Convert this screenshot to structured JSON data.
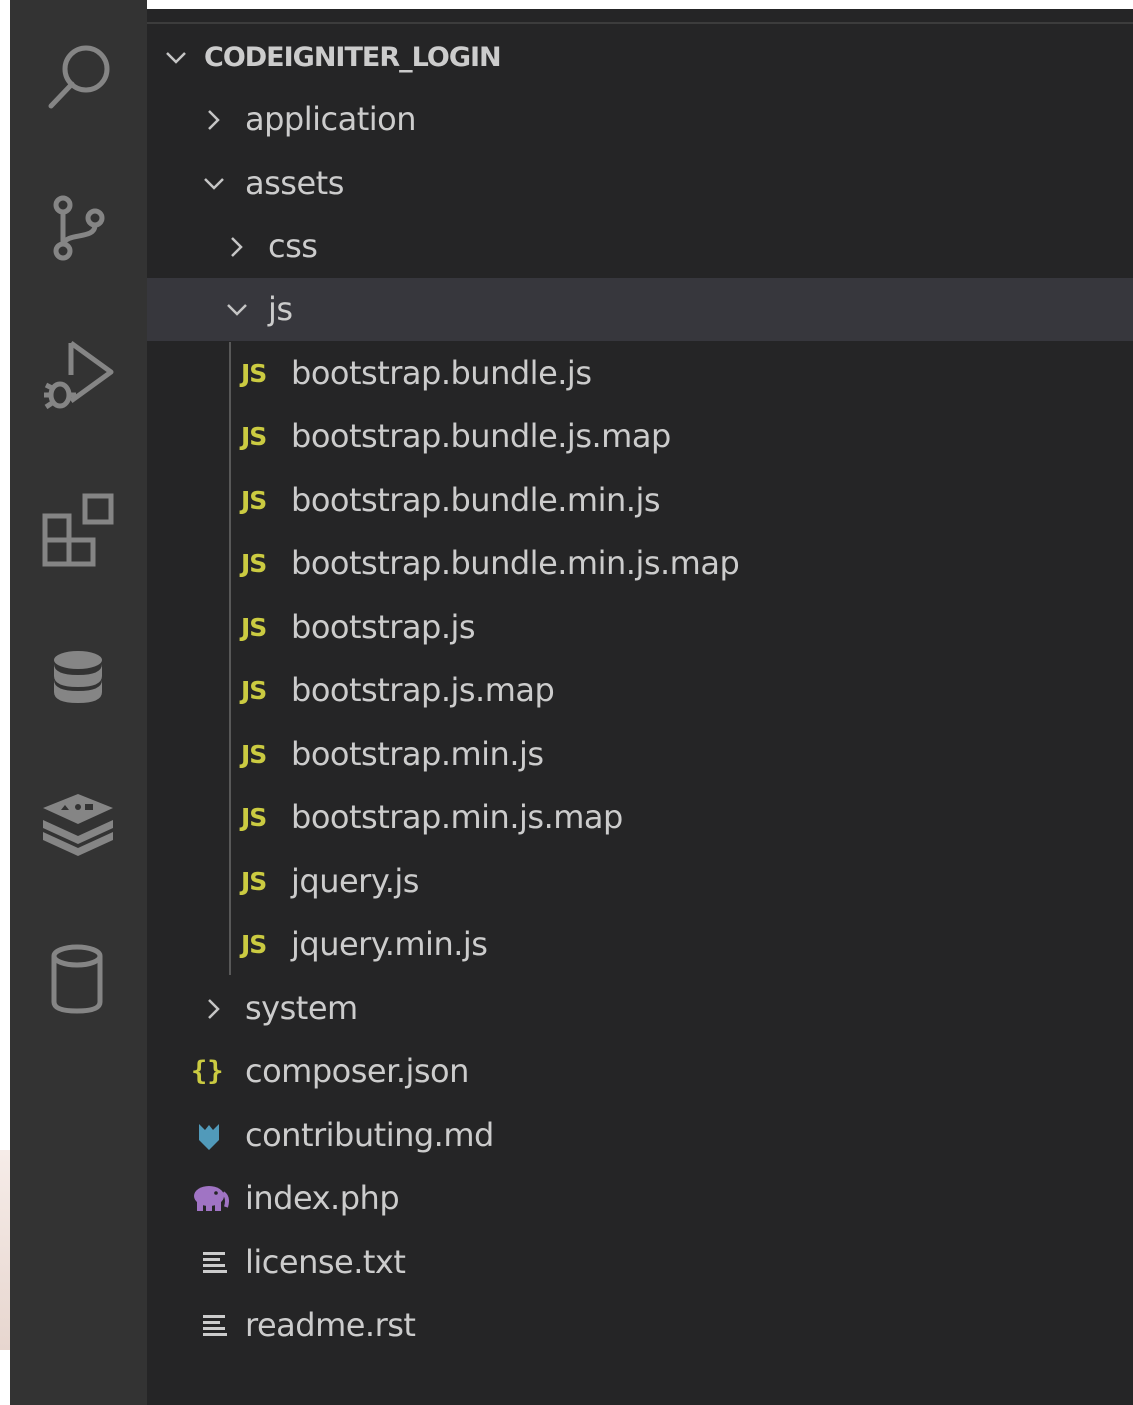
{
  "activity_bar": {
    "icons": [
      {
        "name": "search-icon"
      },
      {
        "name": "source-control-icon"
      },
      {
        "name": "run-and-debug-icon"
      },
      {
        "name": "extensions-icon"
      },
      {
        "name": "database-icon"
      },
      {
        "name": "redis-icon"
      },
      {
        "name": "cylinder-icon"
      }
    ]
  },
  "explorer": {
    "root": {
      "label": "CODEIGNITER_LOGIN",
      "expanded": true
    },
    "items": [
      {
        "label": "application",
        "type": "folder",
        "expanded": false
      },
      {
        "label": "assets",
        "type": "folder",
        "expanded": true
      },
      {
        "label": "css",
        "type": "folder",
        "expanded": false
      },
      {
        "label": "js",
        "type": "folder",
        "expanded": true,
        "selected": true
      },
      {
        "label": "bootstrap.bundle.js",
        "type": "js"
      },
      {
        "label": "bootstrap.bundle.js.map",
        "type": "js"
      },
      {
        "label": "bootstrap.bundle.min.js",
        "type": "js"
      },
      {
        "label": "bootstrap.bundle.min.js.map",
        "type": "js"
      },
      {
        "label": "bootstrap.js",
        "type": "js"
      },
      {
        "label": "bootstrap.js.map",
        "type": "js"
      },
      {
        "label": "bootstrap.min.js",
        "type": "js"
      },
      {
        "label": "bootstrap.min.js.map",
        "type": "js"
      },
      {
        "label": "jquery.js",
        "type": "js"
      },
      {
        "label": "jquery.min.js",
        "type": "js"
      },
      {
        "label": "system",
        "type": "folder",
        "expanded": false
      },
      {
        "label": "composer.json",
        "type": "json"
      },
      {
        "label": "contributing.md",
        "type": "markdown"
      },
      {
        "label": "index.php",
        "type": "php"
      },
      {
        "label": "license.txt",
        "type": "text"
      },
      {
        "label": "readme.rst",
        "type": "text"
      }
    ],
    "js_badge": "JS",
    "json_badge": "{}"
  },
  "colors": {
    "activity_bar": "#333333",
    "sidebar": "#252526",
    "selected_row": "#37373d",
    "text": "#cccccc",
    "js_yellow": "#cbcb41",
    "markdown_blue": "#519aba",
    "php_purple": "#a074c4",
    "icon_gray": "#858585"
  }
}
